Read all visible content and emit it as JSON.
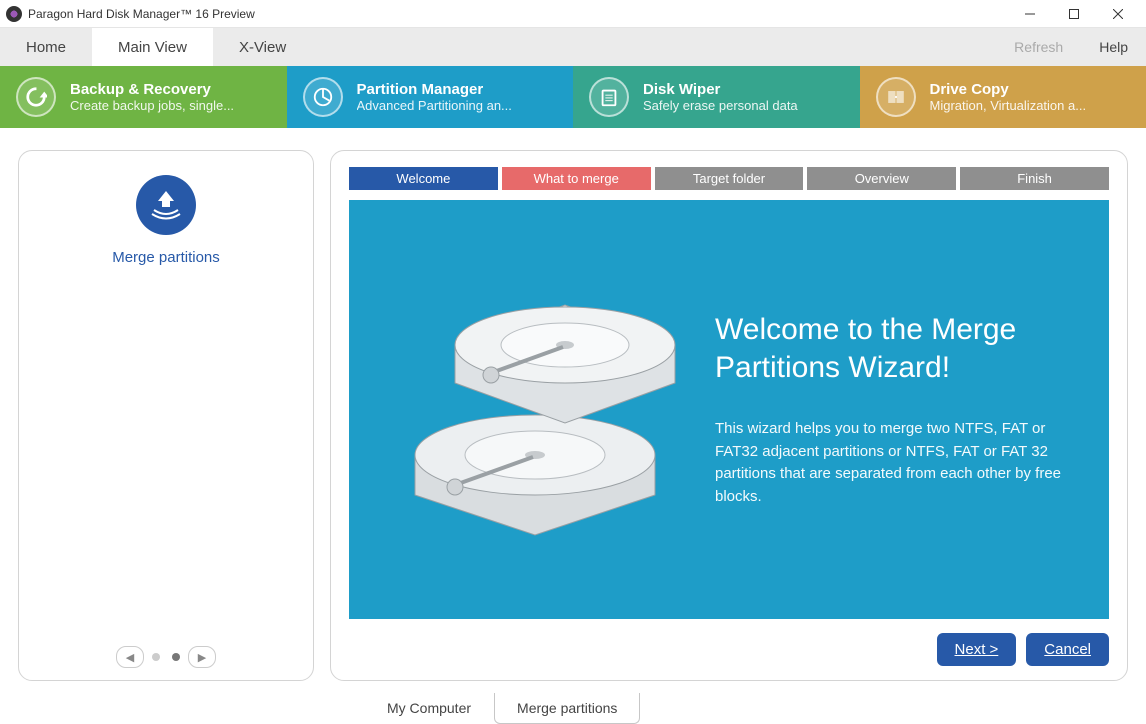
{
  "window": {
    "title": "Paragon Hard Disk Manager™ 16 Preview"
  },
  "menu": {
    "tabs": [
      "Home",
      "Main View",
      "X-View"
    ],
    "active": 1,
    "refresh": "Refresh",
    "help": "Help"
  },
  "sections": [
    {
      "title": "Backup & Recovery",
      "subtitle": "Create backup jobs, single...",
      "color": "green",
      "icon": "backup-icon"
    },
    {
      "title": "Partition Manager",
      "subtitle": "Advanced Partitioning an...",
      "color": "blue",
      "icon": "partition-icon"
    },
    {
      "title": "Disk Wiper",
      "subtitle": "Safely erase personal data",
      "color": "teal",
      "icon": "wiper-icon"
    },
    {
      "title": "Drive Copy",
      "subtitle": "Migration, Virtualization a...",
      "color": "gold",
      "icon": "copy-icon"
    }
  ],
  "leftpanel": {
    "label": "Merge partitions"
  },
  "wizard": {
    "steps": [
      "Welcome",
      "What to merge",
      "Target folder",
      "Overview",
      "Finish"
    ],
    "title": "Welcome to the Merge Partitions Wizard!",
    "description": "This wizard helps you to merge two NTFS, FAT or FAT32 adjacent partitions or NTFS, FAT or FAT 32 partitions that are separated from each other by free blocks.",
    "next": "Next >",
    "cancel": "Cancel"
  },
  "bottomtabs": {
    "items": [
      "My Computer",
      "Merge partitions"
    ],
    "active": 1
  }
}
